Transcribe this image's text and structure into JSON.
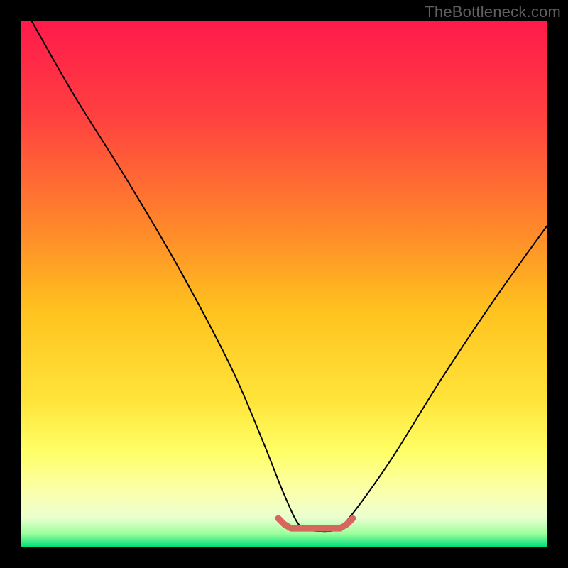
{
  "watermark": "TheBottleneck.com",
  "colors": {
    "frame": "#000000",
    "curve": "#000000",
    "marker": "#d6675f",
    "stops": [
      {
        "offset": 0.0,
        "color": "#ff1a4b"
      },
      {
        "offset": 0.18,
        "color": "#ff4040"
      },
      {
        "offset": 0.4,
        "color": "#ff8a2a"
      },
      {
        "offset": 0.55,
        "color": "#ffc21e"
      },
      {
        "offset": 0.72,
        "color": "#ffe43a"
      },
      {
        "offset": 0.82,
        "color": "#ffff66"
      },
      {
        "offset": 0.9,
        "color": "#faffb0"
      },
      {
        "offset": 0.945,
        "color": "#eaffd0"
      },
      {
        "offset": 0.975,
        "color": "#9cff9c"
      },
      {
        "offset": 1.0,
        "color": "#00e07a"
      }
    ]
  },
  "chart_data": {
    "type": "line",
    "title": "",
    "xlabel": "",
    "ylabel": "",
    "xlim": [
      0,
      100
    ],
    "ylim": [
      0,
      100
    ],
    "series": [
      {
        "name": "bottleneck-curve",
        "x": [
          2,
          10,
          20,
          30,
          40,
          46,
          50,
          53,
          56,
          59,
          62,
          70,
          80,
          90,
          100
        ],
        "values": [
          100,
          86,
          70,
          53,
          34,
          20,
          10,
          4,
          3,
          3,
          5,
          16,
          32,
          47,
          61
        ]
      }
    ],
    "flat_region": {
      "x_start": 50,
      "x_end": 62,
      "y": 3.5
    }
  }
}
